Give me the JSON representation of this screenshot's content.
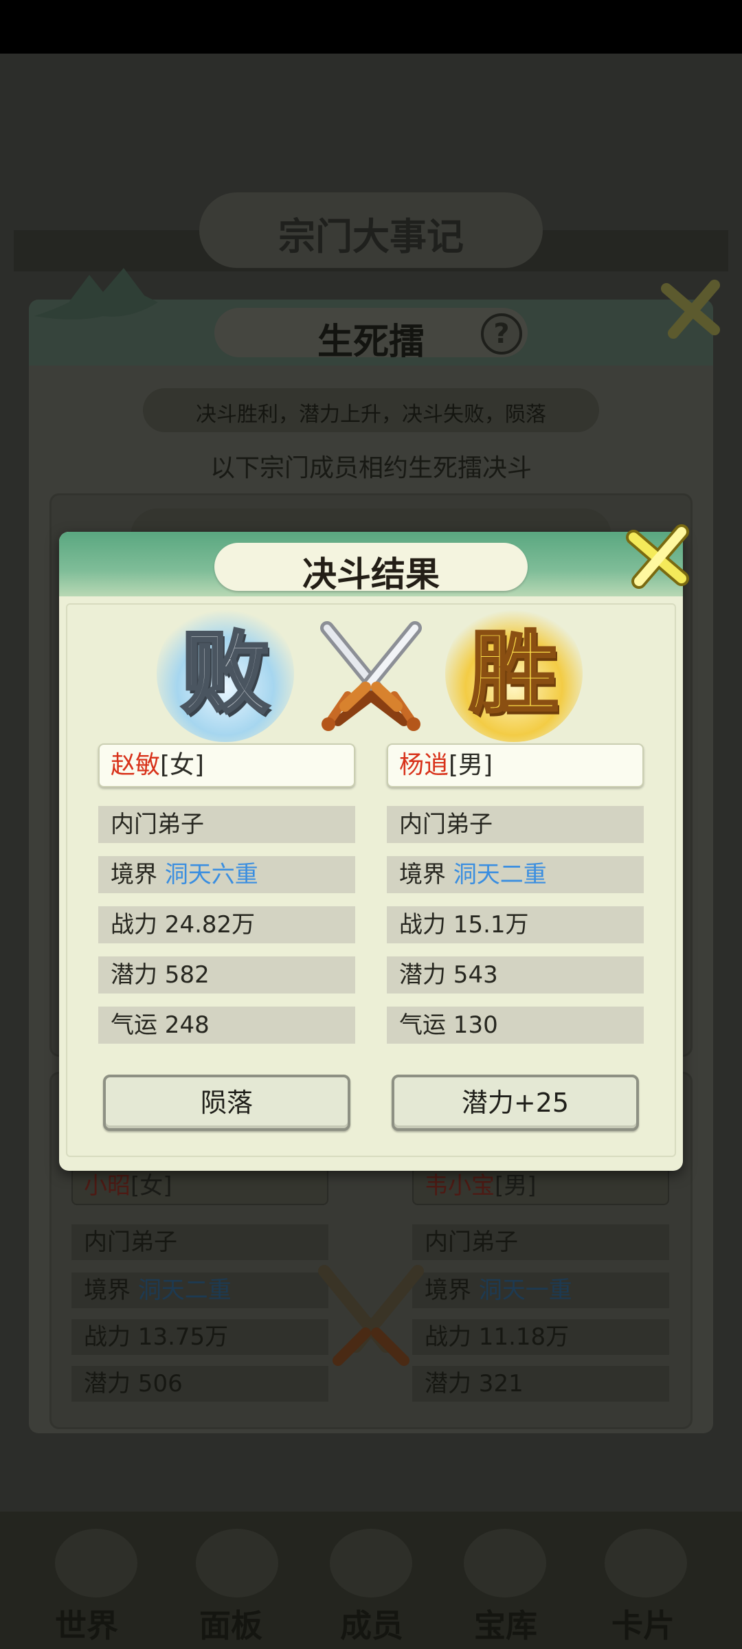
{
  "background": {
    "page_title": "宗门大事记",
    "panel_title": "生死擂",
    "help_symbol": "?",
    "rule_text": "决斗胜利，潜力上升，决斗失败，陨落",
    "subtitle": "以下宗门成员相约生死擂决斗",
    "card_pill_text": "",
    "bottom_left": {
      "name": "小昭",
      "gender": "[女]",
      "rank": "内门弟子",
      "realm_label": "境界",
      "realm": "洞天二重",
      "power": "战力 13.75万",
      "potential": "潜力 506"
    },
    "bottom_right": {
      "name": "韦小宝",
      "gender": "[男]",
      "rank": "内门弟子",
      "realm_label": "境界",
      "realm": "洞天一重",
      "power": "战力 11.18万",
      "potential": "潜力 321"
    },
    "nav": [
      "世界",
      "面板",
      "成员",
      "宝库",
      "卡片"
    ]
  },
  "dialog": {
    "title": "决斗结果",
    "loser_badge": "败",
    "winner_badge": "胜",
    "loser": {
      "name": "赵敏",
      "gender": "[女]",
      "rank": "内门弟子",
      "realm_label": "境界",
      "realm": "洞天六重",
      "power": "战力 24.82万",
      "potential": "潜力 582",
      "luck": "气运 248"
    },
    "winner": {
      "name": "杨逍",
      "gender": "[男]",
      "rank": "内门弟子",
      "realm_label": "境界",
      "realm": "洞天二重",
      "power": "战力 15.1万",
      "potential": "潜力 543",
      "luck": "气运 130"
    },
    "loser_result": "陨落",
    "winner_result": "潜力+25"
  },
  "colors": {
    "header_green": "#5aa780",
    "name_red": "#d8321a",
    "realm_blue": "#3a8ee0",
    "dialog_bg": "#ecefd6"
  }
}
